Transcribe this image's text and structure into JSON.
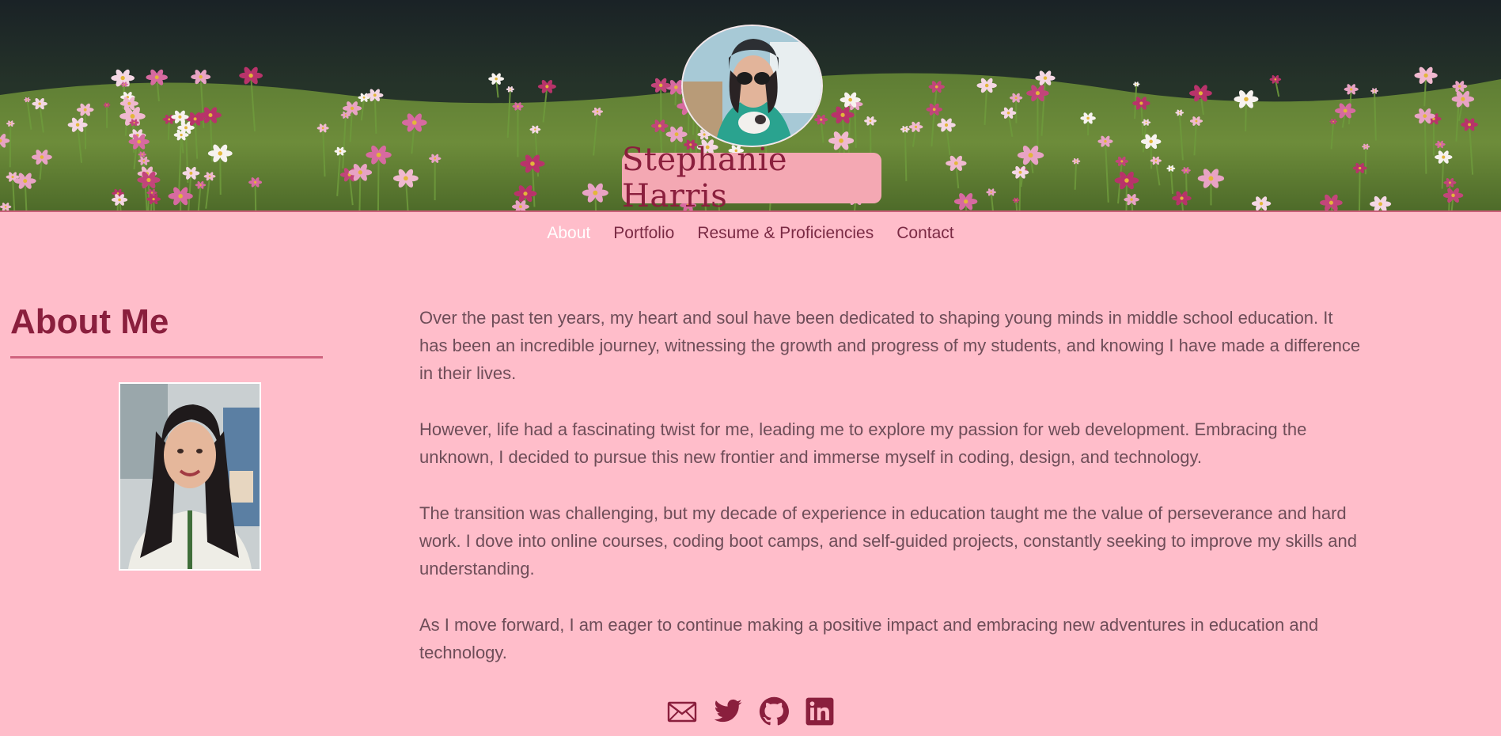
{
  "header": {
    "name": "Stephanie Harris"
  },
  "nav": {
    "items": [
      {
        "label": "About",
        "active": true
      },
      {
        "label": "Portfolio",
        "active": false
      },
      {
        "label": "Resume & Proficiencies",
        "active": false
      },
      {
        "label": "Contact",
        "active": false
      }
    ]
  },
  "about": {
    "heading": "About Me",
    "paragraphs": [
      "Over the past ten years, my heart and soul have been dedicated to shaping young minds in middle school education. It has been an incredible journey, witnessing the growth and progress of my students, and knowing I have made a difference in their lives.",
      "However, life had a fascinating twist for me, leading me to explore my passion for web development. Embracing the unknown, I decided to pursue this new frontier and immerse myself in coding, design, and technology.",
      "The transition was challenging, but my decade of experience in education taught me the value of perseverance and hard work. I dove into online courses, coding boot camps, and self-guided projects, constantly seeking to improve my skills and understanding.",
      "As I move forward, I am eager to continue making a positive impact and embracing new adventures in education and technology."
    ]
  },
  "social": {
    "icons": [
      "mail-icon",
      "twitter-icon",
      "github-icon",
      "linkedin-icon"
    ]
  },
  "colors": {
    "page_bg": "#ffbdca",
    "accent": "#8a1f3d",
    "name_plate": "#f4a8b3",
    "text": "#6e4d58"
  }
}
